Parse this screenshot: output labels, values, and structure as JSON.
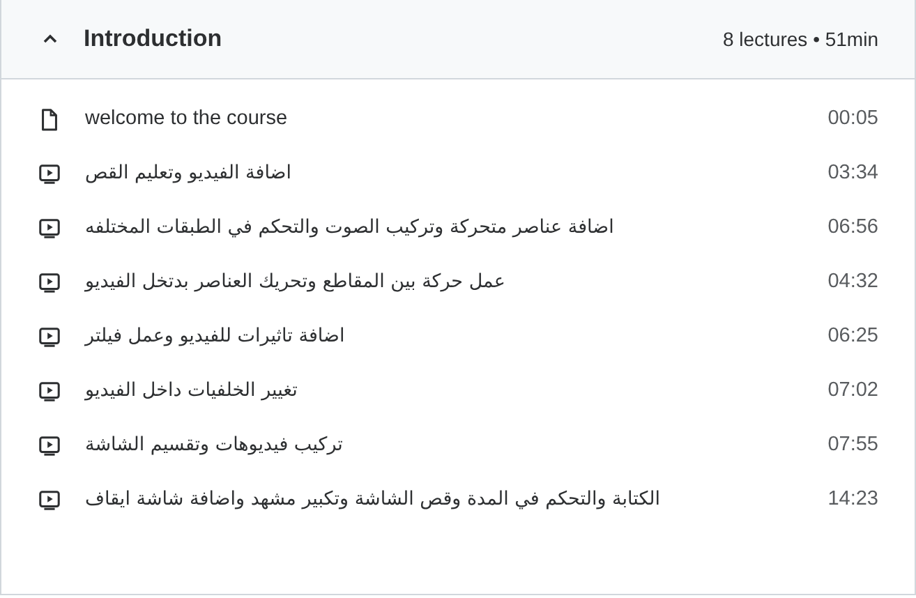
{
  "section": {
    "title": "Introduction",
    "expanded": true,
    "summary": "8 lectures • 51min"
  },
  "lectures": [
    {
      "kind": "article",
      "title": "welcome to the course",
      "duration": "00:05"
    },
    {
      "kind": "video",
      "title": "اضافة الفيديو وتعليم القص",
      "duration": "03:34"
    },
    {
      "kind": "video",
      "title": "اضافة عناصر متحركة وتركيب الصوت والتحكم في الطبقات المختلفه",
      "duration": "06:56"
    },
    {
      "kind": "video",
      "title": "عمل حركة بين المقاطع وتحريك العناصر بدتخل الفيديو",
      "duration": "04:32"
    },
    {
      "kind": "video",
      "title": "اضافة تاثيرات للفيديو وعمل فيلتر",
      "duration": "06:25"
    },
    {
      "kind": "video",
      "title": "تغيير الخلفيات داخل الفيديو",
      "duration": "07:02"
    },
    {
      "kind": "video",
      "title": "تركيب فيديوهات وتقسيم الشاشة",
      "duration": "07:55"
    },
    {
      "kind": "video",
      "title": "الكتابة والتحكم في المدة وقص الشاشة وتكبير مشهد واضافة شاشة ايقاف",
      "duration": "14:23"
    }
  ]
}
